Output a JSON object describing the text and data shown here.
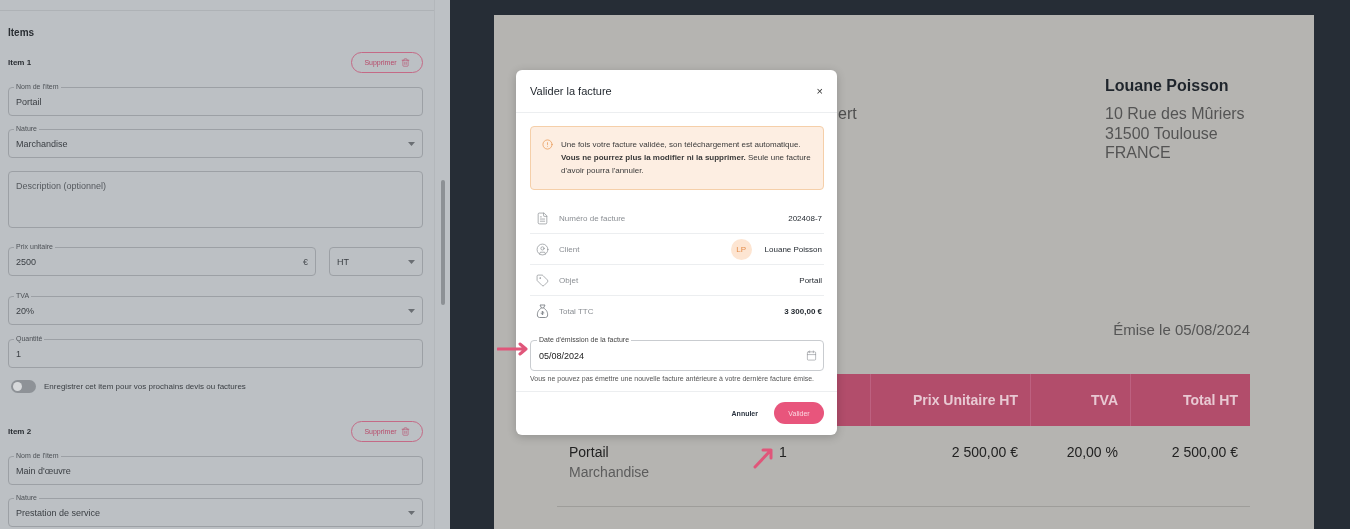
{
  "form": {
    "section_title": "Items",
    "items": [
      {
        "title": "Item 1",
        "delete_label": "Supprimer",
        "fields": [
          {
            "kind": "text",
            "label": "Nom de l'item",
            "value": "Portail"
          },
          {
            "kind": "select",
            "label": "Nature",
            "value": "Marchandise"
          },
          {
            "kind": "textarea",
            "placeholder": "Description (optionnel)"
          },
          {
            "kind": "price",
            "label": "Prix unitaire",
            "value": "2500",
            "suffix": "€",
            "unit": "HT"
          },
          {
            "kind": "select",
            "label": "TVA",
            "value": "20%"
          },
          {
            "kind": "text",
            "label": "Quantité",
            "value": "1"
          }
        ],
        "save_toggle": {
          "label": "Enregistrer cet item pour vos prochains devis ou factures",
          "on": false
        }
      },
      {
        "title": "Item 2",
        "delete_label": "Supprimer",
        "fields": [
          {
            "kind": "text",
            "label": "Nom de l'item",
            "value": "Main d'œuvre"
          },
          {
            "kind": "select",
            "label": "Nature",
            "value": "Prestation de service"
          }
        ]
      }
    ]
  },
  "invoice": {
    "sender_fragment": "ert",
    "client": {
      "name": "Louane Poisson",
      "address_lines": [
        "10 Rue des Mûriers",
        "31500 Toulouse",
        "FRANCE"
      ]
    },
    "issue_date": "Émise le 05/08/2024",
    "table": {
      "columns": [
        "Prix Unitaire HT",
        "TVA",
        "Total HT"
      ],
      "rows": [
        {
          "name": "Portail",
          "nature": "Marchandise",
          "quantity": "1",
          "unit_price": "2 500,00 €",
          "vat": "20,00 %",
          "total": "2 500,00 €"
        }
      ]
    }
  },
  "dialog": {
    "title": "Valider la facture",
    "close": "×",
    "alert": "Une fois votre facture validée, son téléchargement est automatique. **Vous ne pourrez plus la modifier ni la supprimer.** Seule une facture d'avoir pourra l'annuler.",
    "details": [
      {
        "kind": "document",
        "label": "Numéro de facture",
        "value": "202408-7",
        "strong": false
      },
      {
        "kind": "user",
        "label": "Client",
        "value": "Louane Poisson",
        "avatar": "LP",
        "strong": false
      },
      {
        "kind": "tag",
        "label": "Objet",
        "value": "Portail",
        "strong": false
      },
      {
        "kind": "money-bag",
        "label": "Total TTC",
        "value": "3 300,00 €",
        "strong": true
      }
    ],
    "date_field": {
      "label": "Date d'émission de la facture",
      "value": "05/08/2024",
      "helper": "Vous ne pouvez pas émettre une nouvelle facture antérieure à votre dernière facture émise."
    },
    "cancel": "Annuler",
    "confirm": "Valider"
  }
}
